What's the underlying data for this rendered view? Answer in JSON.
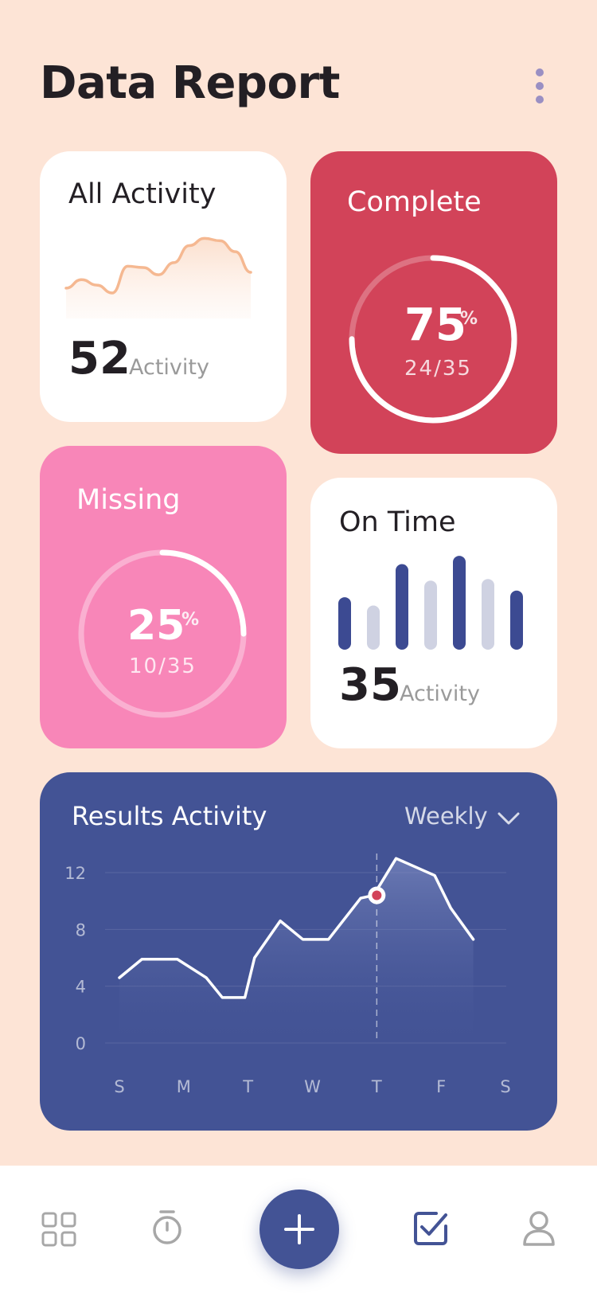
{
  "page": {
    "title": "Data Report"
  },
  "cards": {
    "all_activity": {
      "title": "All Activity",
      "value": "52",
      "unit": "Activity"
    },
    "complete": {
      "title": "Complete",
      "percent": "75",
      "percent_sign": "%",
      "fraction": "24/35",
      "progress": 0.75
    },
    "missing": {
      "title": "Missing",
      "percent": "25",
      "percent_sign": "%",
      "fraction": "10/35",
      "progress": 0.25
    },
    "on_time": {
      "title": "On Time",
      "value": "35",
      "unit": "Activity"
    },
    "results": {
      "title": "Results Activity",
      "period": "Weekly"
    }
  },
  "colors": {
    "background": "#fde4d6",
    "complete_card": "#d24359",
    "missing_card": "#f886b8",
    "results_card": "#435395",
    "accent_orange": "#f5b891",
    "bar_dark": "#3c4a92",
    "bar_light": "#cfd2e2"
  },
  "chart_data": [
    {
      "type": "area",
      "name": "all-activity-sparkline",
      "x": [
        0,
        1,
        2,
        3,
        4,
        5,
        6,
        7,
        8,
        9,
        10,
        11,
        12
      ],
      "values": [
        5,
        6.4,
        5.5,
        4.2,
        8.6,
        8.4,
        7.2,
        9.2,
        12,
        13.2,
        12.8,
        11,
        7.6
      ],
      "ylim": [
        0,
        16
      ]
    },
    {
      "type": "bar",
      "name": "on-time-bars",
      "values": [
        0.48,
        0.38,
        0.88,
        0.68,
        0.98,
        0.7,
        0.56
      ],
      "colors": [
        "dark",
        "light",
        "dark",
        "light",
        "dark",
        "light",
        "dark"
      ],
      "ylim": [
        0,
        1
      ]
    },
    {
      "type": "area",
      "name": "results-activity",
      "categories": [
        "S",
        "M",
        "T",
        "W",
        "T",
        "F",
        "S"
      ],
      "x": [
        0,
        0.35,
        0.9,
        1.35,
        1.6,
        1.95,
        2.1,
        2.5,
        2.85,
        3.25,
        3.75,
        3.95,
        4.3,
        4.9,
        5.15,
        5.5
      ],
      "values": [
        4.6,
        5.9,
        5.9,
        4.6,
        3.2,
        3.2,
        6.0,
        8.6,
        7.3,
        7.3,
        10.2,
        10.4,
        13.0,
        11.8,
        9.5,
        7.3
      ],
      "highlight_x": 4,
      "highlight_value": 10.4,
      "yticks": [
        "0",
        "4",
        "8",
        "12"
      ],
      "ylim": [
        0,
        12
      ]
    }
  ],
  "nav": [
    {
      "icon": "dashboard-grid-icon"
    },
    {
      "icon": "stopwatch-icon"
    },
    {
      "icon": "plus-icon"
    },
    {
      "icon": "checkbox-icon"
    },
    {
      "icon": "user-icon"
    }
  ]
}
